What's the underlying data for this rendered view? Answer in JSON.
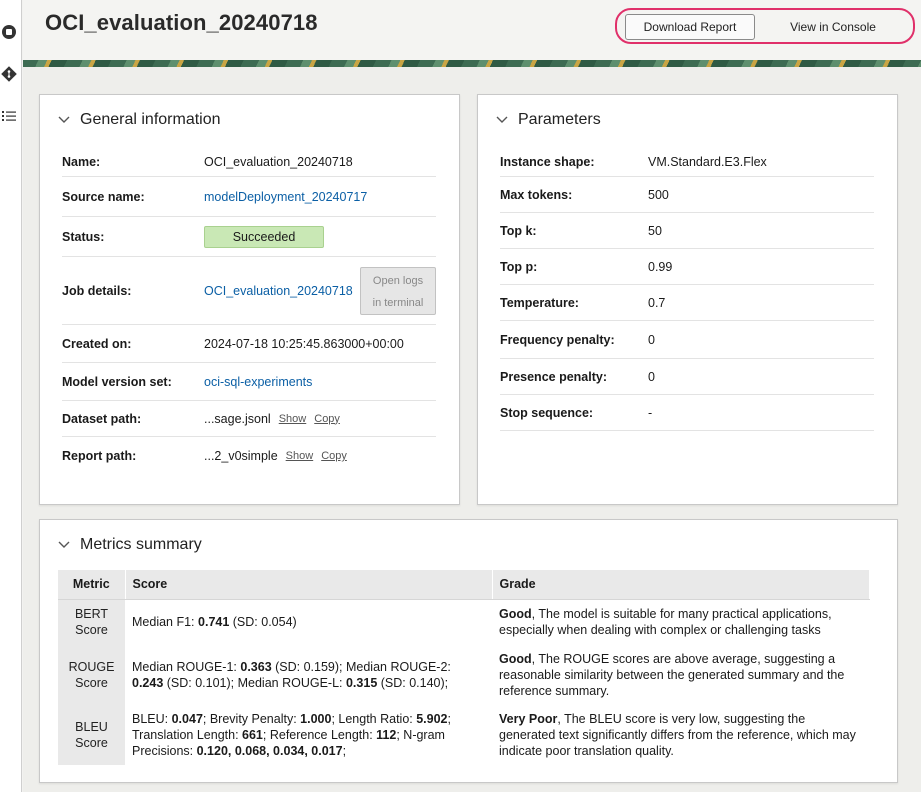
{
  "header": {
    "title": "OCI_evaluation_20240718",
    "download_label": "Download Report",
    "console_label": "View in Console"
  },
  "rail": {
    "icons": [
      "stop-circle-icon",
      "git-icon",
      "list-icon"
    ]
  },
  "general": {
    "title": "General information",
    "rows": [
      {
        "label": "Name:",
        "value": "OCI_evaluation_20240718"
      },
      {
        "label": "Source name:",
        "value": "modelDeployment_20240717"
      },
      {
        "label": "Status:",
        "value": "Succeeded"
      },
      {
        "label": "Job details:",
        "value": "OCI_evaluation_20240718"
      },
      {
        "label": "Created on:",
        "value": "2024-07-18 10:25:45.863000+00:00"
      },
      {
        "label": "Model version set:",
        "value": "oci-sql-experiments"
      },
      {
        "label": "Dataset path:",
        "value": "...sage.jsonl"
      },
      {
        "label": "Report path:",
        "value": "...2_v0simple"
      }
    ],
    "open_logs_line1": "Open logs",
    "open_logs_line2": "in terminal",
    "show_label": "Show",
    "copy_label": "Copy"
  },
  "params": {
    "title": "Parameters",
    "rows": [
      {
        "label": "Instance shape:",
        "value": "VM.Standard.E3.Flex"
      },
      {
        "label": "Max tokens:",
        "value": "500"
      },
      {
        "label": "Top k:",
        "value": "50"
      },
      {
        "label": "Top p:",
        "value": "0.99"
      },
      {
        "label": "Temperature:",
        "value": "0.7"
      },
      {
        "label": "Frequency penalty:",
        "value": "0"
      },
      {
        "label": "Presence penalty:",
        "value": "0"
      },
      {
        "label": "Stop sequence:",
        "value": "-"
      }
    ]
  },
  "metrics": {
    "title": "Metrics summary",
    "headers": [
      "Metric",
      "Score",
      "Grade"
    ],
    "rows": [
      {
        "metric": "BERT Score",
        "score_parts": [
          "Median F1: ",
          "0.741",
          " (SD: 0.054)"
        ],
        "grade_bold": "Good",
        "grade_text": ", The model is suitable for many practical applications, especially when dealing with complex or challenging tasks"
      },
      {
        "metric": "ROUGE Score",
        "score_parts": [
          "Median ROUGE-1: ",
          "0.363",
          " (SD: 0.159); Median ROUGE-2: ",
          "0.243",
          " (SD: 0.101); Median ROUGE-L: ",
          "0.315",
          " (SD: 0.140);"
        ],
        "grade_bold": "Good",
        "grade_text": ", The ROUGE scores are above average, suggesting a reasonable similarity between the generated summary and the reference summary."
      },
      {
        "metric": "BLEU Score",
        "score_parts": [
          "BLEU: ",
          "0.047",
          "; Brevity Penalty: ",
          "1.000",
          "; Length Ratio: ",
          "5.902",
          "; Translation Length: ",
          "661",
          "; Reference Length: ",
          "112",
          "; N-gram Precisions: ",
          "0.120, 0.068, 0.034, 0.017",
          ";"
        ],
        "grade_bold": "Very Poor",
        "grade_text": ", The BLEU score is very low, suggesting the generated text significantly differs from the reference, which may indicate poor translation quality."
      }
    ]
  },
  "colors": {
    "accent_ring": "#e0306a",
    "link": "#0b5fa5",
    "status_success": "#c9e8b5"
  }
}
